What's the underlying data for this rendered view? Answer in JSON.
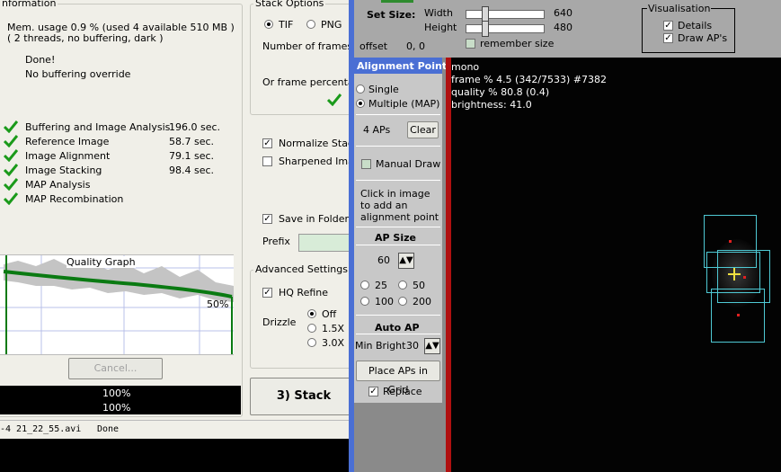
{
  "info": {
    "group_title": "nformation",
    "mem_line": "Mem. usage 0.9 %  (used 4 available 510 MB )",
    "threads_line": "( 2 threads, no buffering, dark  )",
    "done": "Done!",
    "buffering": "No buffering override",
    "steps": [
      {
        "label": "Buffering and Image Analysis",
        "time": "196.0 sec."
      },
      {
        "label": "Reference Image",
        "time": "58.7 sec."
      },
      {
        "label": "Image Alignment",
        "time": "79.1 sec."
      },
      {
        "label": "Image Stacking",
        "time": "98.4 sec."
      },
      {
        "label": "MAP Analysis",
        "time": ""
      },
      {
        "label": "MAP Recombination",
        "time": ""
      }
    ],
    "graph_title": "Quality Graph",
    "graph_marker": "50%",
    "cancel": "Cancel...",
    "progress1": "100%",
    "progress2": "100%",
    "status_file": "-4 21_22_55.avi",
    "status_state": "Done"
  },
  "stack": {
    "group_title": "Stack Options",
    "tif": "TIF",
    "png": "PNG",
    "frames_label": "Number of frames to",
    "percentage_label": "Or frame percentage",
    "normalize": "Normalize Stack",
    "sharpened": "Sharpened Imag",
    "save_folders": "Save in Folders",
    "prefix": "Prefix",
    "advanced_title": "Advanced Settings",
    "hq_refine": "HQ Refine",
    "drizzle": "Drizzle",
    "drizzle_off": "Off",
    "drizzle_15": "1.5X",
    "drizzle_30": "3.0X",
    "stack_button": "3) Stack"
  },
  "top": {
    "set_size": "Set Size:",
    "width_label": "Width",
    "width_val": "640",
    "height_label": "Height",
    "height_val": "480",
    "offset_label": "offset",
    "offset_val": "0, 0",
    "remember": "remember size",
    "vis_title": "Visualisation",
    "details": "Details",
    "draw_aps": "Draw AP's"
  },
  "ap": {
    "title": "Alignment Points",
    "single": "Single",
    "multiple": "Multiple (MAP)",
    "count": "4 APs",
    "clear": "Clear",
    "manual_draw": "Manual Draw",
    "hint1": "Click in image",
    "hint2": "to add an",
    "hint3": "alignment point",
    "size_title": "AP Size",
    "size_val": "60",
    "s25": "25",
    "s50": "50",
    "s100": "100",
    "s200": "200",
    "auto_title": "Auto AP",
    "min_bright_label": "Min Bright",
    "min_bright_val": "30",
    "place_grid": "Place APs in Grid",
    "replace": "Replace"
  },
  "viewer": {
    "mono": "mono",
    "frame": "frame % 4.5 (342/7533) #7382",
    "quality": "quality % 80.8  (0.4)",
    "brightness": "brightness: 41.0"
  }
}
